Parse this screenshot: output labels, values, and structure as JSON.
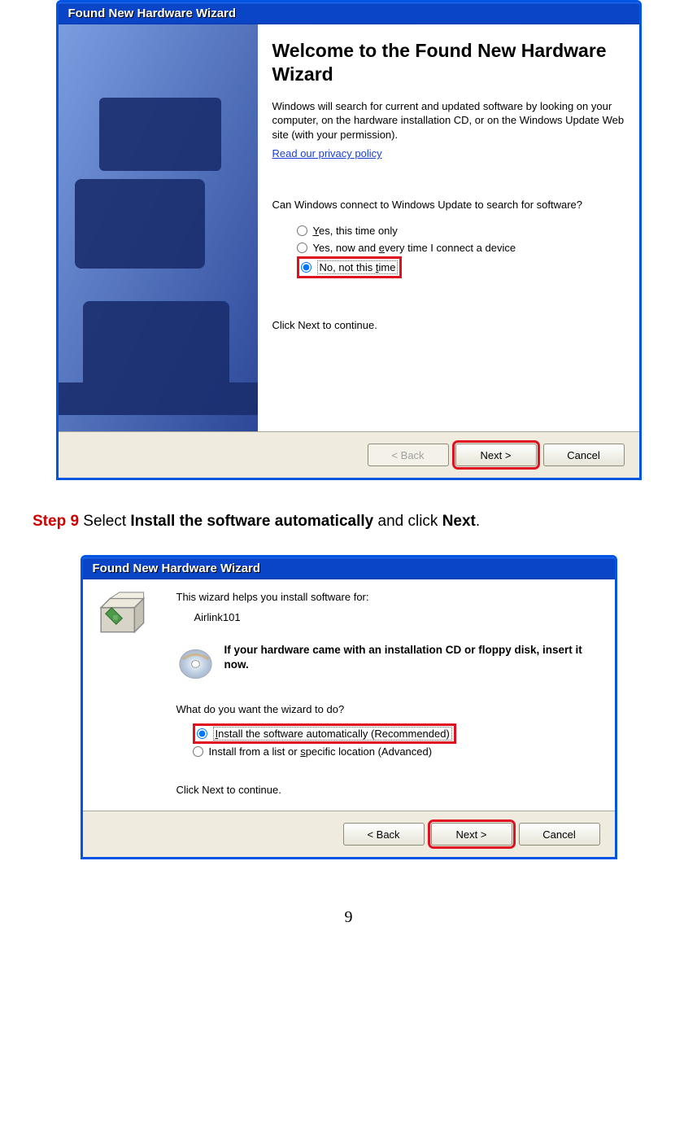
{
  "dialog1": {
    "title": "Found New Hardware Wizard",
    "heading": "Welcome to the Found New Hardware Wizard",
    "intro": "Windows will search for current and updated software by looking on your computer, on the hardware installation CD, or on the Windows Update Web site (with your permission).",
    "privacy_link": "Read our privacy policy",
    "question": "Can Windows connect to Windows Update to search for software?",
    "radios": {
      "opt1": "Yes, this time only",
      "opt2": "Yes, now and every time I connect a device",
      "opt3": "No, not this time"
    },
    "continue_text": "Click Next to continue.",
    "buttons": {
      "back": "< Back",
      "next": "Next >",
      "cancel": "Cancel"
    }
  },
  "step9": {
    "prefix": "Step 9",
    "text_select": " Select ",
    "bold1": "Install the software automatically",
    "text_and": " and click ",
    "bold2": "Next",
    "period": "."
  },
  "dialog2": {
    "title": "Found New Hardware Wizard",
    "line1": "This wizard helps you install software for:",
    "device": "Airlink101",
    "cd_text": "If your hardware came with an installation CD or floppy disk, insert it now.",
    "question": "What do you want the wizard to do?",
    "radios": {
      "opt1": "Install the software automatically (Recommended)",
      "opt2": "Install from a list or specific location (Advanced)"
    },
    "continue_text": "Click Next to continue.",
    "buttons": {
      "back": "< Back",
      "next": "Next >",
      "cancel": "Cancel"
    }
  },
  "page_number": "9"
}
